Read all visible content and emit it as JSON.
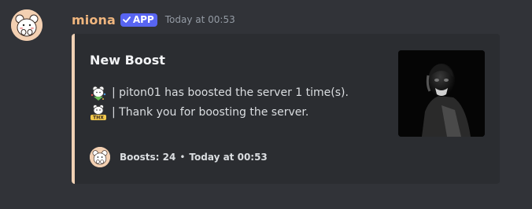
{
  "message": {
    "username": "miona",
    "badge": "APP",
    "timestamp": "Today at 00:53",
    "colors": {
      "username": "#f0b67e",
      "badge_bg": "#5865f2",
      "embed_border": "#f0d1b4",
      "background": "#313338",
      "embed_bg": "#2b2d31"
    },
    "avatar_icon": "bear-avatar-icon",
    "embed": {
      "title": "New Boost",
      "lines": [
        "| piton01 has boosted the server 1 time(s).",
        "| Thank you for boosting the server."
      ],
      "emoji_icons": [
        "bear-celebration-emoji-icon",
        "bear-thx-emoji-icon"
      ],
      "thumbnail_icon": "soldier-portrait-thumbnail",
      "footer": {
        "text": "Boosts: 24",
        "separator": "•",
        "timestamp": "Today at 00:53"
      }
    }
  }
}
